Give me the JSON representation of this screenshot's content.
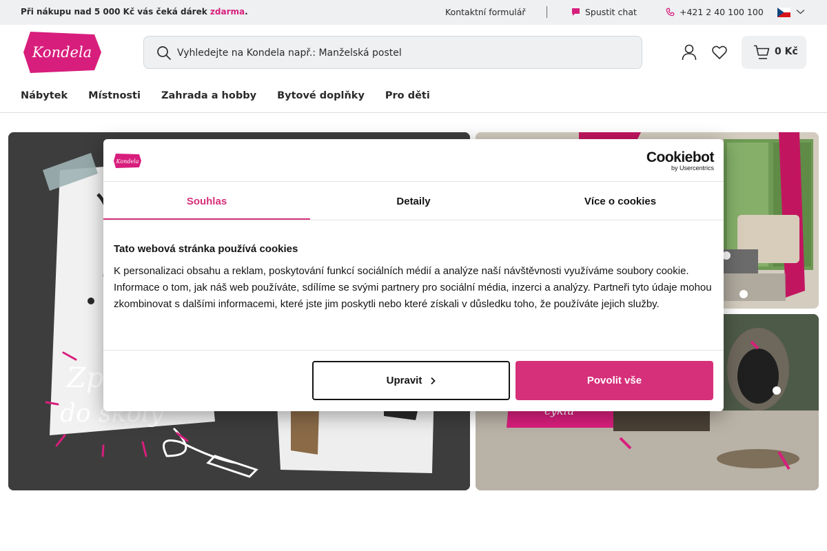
{
  "topbar": {
    "promo_prefix": "Při nákupu nad 5 000 Kč vás čeká dárek",
    "promo_highlight": "zdarma",
    "promo_suffix": ".",
    "contact_label": "Kontaktní formulář",
    "chat_label": "Spustit chat",
    "phone_label": "+421 2 40 100 100",
    "language": "CZ"
  },
  "header": {
    "logo_text": "Kondela",
    "search_placeholder": "Vyhledejte na Kondela např.: Manželská postel",
    "cart_amount": "0 Kč"
  },
  "nav": {
    "items": [
      {
        "label": "Nábytek"
      },
      {
        "label": "Místnosti"
      },
      {
        "label": "Zahrada a hobby"
      },
      {
        "label": "Bytové doplňky"
      },
      {
        "label": "Pro děti"
      }
    ]
  },
  "banners": {
    "main_text_line1": "Zp",
    "main_text_line2": "do školy",
    "bottom_right_text": "cyklu"
  },
  "cookie_dialog": {
    "logo_text": "Kondela",
    "brand_name": "Cookiebot",
    "brand_sub": "by Usercentrics",
    "tabs": [
      {
        "label": "Souhlas"
      },
      {
        "label": "Detaily"
      },
      {
        "label": "Více o cookies"
      }
    ],
    "title": "Tato webová stránka používá cookies",
    "body": "K personalizaci obsahu a reklam, poskytování funkcí sociálních médií a analýze naší návštěvnosti využíváme soubory cookie. Informace o tom, jak náš web používáte, sdílíme se svými partnery pro sociální média, inzerci a analýzy. Partneři tyto údaje mohou zkombinovat s dalšími informacemi, které jste jim poskytli nebo které získali v důsledku toho, že používáte jejich služby.",
    "customize_label": "Upravit",
    "allow_all_label": "Povolit vše"
  },
  "colors": {
    "brand": "#d81e7c",
    "cookie_accent": "#d6307a"
  }
}
